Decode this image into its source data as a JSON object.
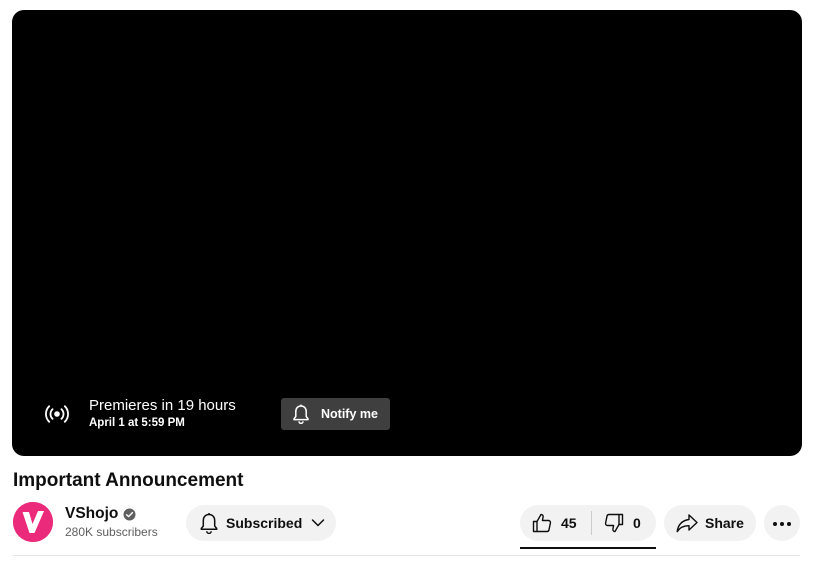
{
  "player": {
    "premiere_status": "Premieres in 19 hours",
    "premiere_date": "April 1 at 5:59 PM",
    "notify_label": "Notify me",
    "live_icon": "live-broadcast-icon"
  },
  "video": {
    "title": "Important Announcement"
  },
  "channel": {
    "name": "VShojo",
    "subscribers": "280K subscribers",
    "avatar_letter": "V",
    "avatar_color": "#ec2a7b",
    "verified": true
  },
  "actions": {
    "subscribe_label": "Subscribed",
    "like_count": "45",
    "dislike_count": "0",
    "share_label": "Share"
  },
  "colors": {
    "player_bg": "#000000",
    "pill_bg": "#f2f2f2",
    "notify_bg": "#3f3f3f",
    "text_primary": "#0f0f0f",
    "text_secondary": "#606060"
  }
}
